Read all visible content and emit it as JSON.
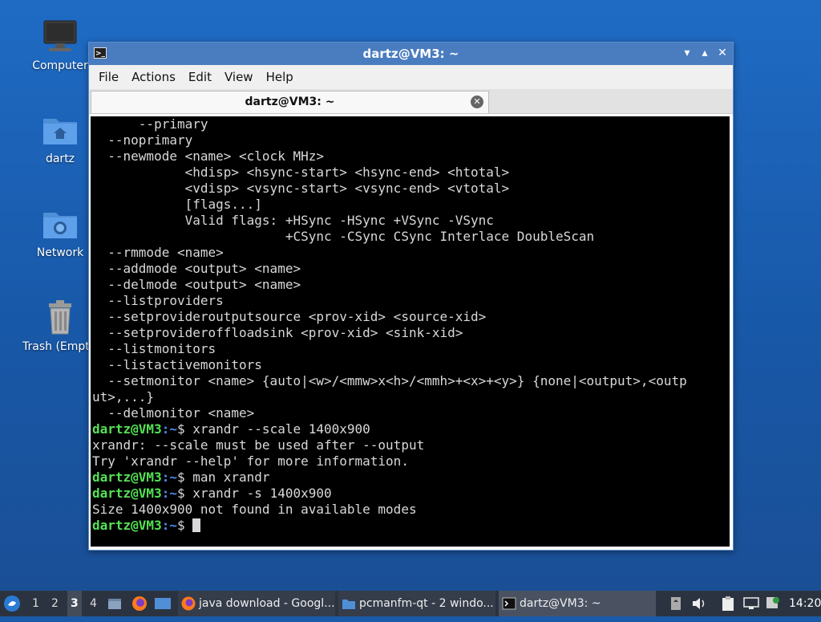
{
  "desktop": {
    "icons": [
      {
        "label": "Computer",
        "icon": "computer-icon"
      },
      {
        "label": "dartz",
        "icon": "home-folder-icon"
      },
      {
        "label": "Network",
        "icon": "network-folder-icon"
      },
      {
        "label": "Trash (Empty)",
        "icon": "trash-icon"
      }
    ]
  },
  "window": {
    "title": "dartz@VM3: ~",
    "minimize": "▾",
    "maximize": "▴",
    "close": "✕",
    "menu": [
      "File",
      "Actions",
      "Edit",
      "View",
      "Help"
    ],
    "tab": {
      "label": "dartz@VM3: ~",
      "close": "✕"
    }
  },
  "terminal": {
    "lines": [
      "      --primary",
      "  --noprimary",
      "  --newmode <name> <clock MHz>",
      "            <hdisp> <hsync-start> <hsync-end> <htotal>",
      "            <vdisp> <vsync-start> <vsync-end> <vtotal>",
      "            [flags...]",
      "            Valid flags: +HSync -HSync +VSync -VSync",
      "                         +CSync -CSync CSync Interlace DoubleScan",
      "  --rmmode <name>",
      "  --addmode <output> <name>",
      "  --delmode <output> <name>",
      "  --listproviders",
      "  --setprovideroutputsource <prov-xid> <source-xid>",
      "  --setprovideroffloadsink <prov-xid> <sink-xid>",
      "  --listmonitors",
      "  --listactivemonitors",
      "  --setmonitor <name> {auto|<w>/<mmw>x<h>/<mmh>+<x>+<y>} {none|<output>,<outp",
      "ut>,...}",
      "  --delmonitor <name>"
    ],
    "prompt_user": "dartz@VM3",
    "prompt_path": ":~",
    "prompt_symbol": "$ ",
    "session": [
      {
        "type": "cmd",
        "text": "xrandr --scale 1400x900"
      },
      {
        "type": "out",
        "text": "xrandr: --scale must be used after --output"
      },
      {
        "type": "out",
        "text": "Try 'xrandr --help' for more information."
      },
      {
        "type": "cmd",
        "text": "man xrandr"
      },
      {
        "type": "cmd",
        "text": "xrandr -s 1400x900"
      },
      {
        "type": "out",
        "text": "Size 1400x900 not found in available modes"
      },
      {
        "type": "prompt",
        "text": ""
      }
    ]
  },
  "taskbar": {
    "workspaces": [
      "1",
      "2",
      "3",
      "4"
    ],
    "active_workspace": "3",
    "tasks": [
      {
        "label": "java download - Googl...",
        "icon": "firefox-icon"
      },
      {
        "label": "pcmanfm-qt - 2 windo...",
        "icon": "folder-icon"
      },
      {
        "label": "dartz@VM3: ~",
        "icon": "terminal-icon"
      }
    ],
    "clock": "14:20"
  }
}
